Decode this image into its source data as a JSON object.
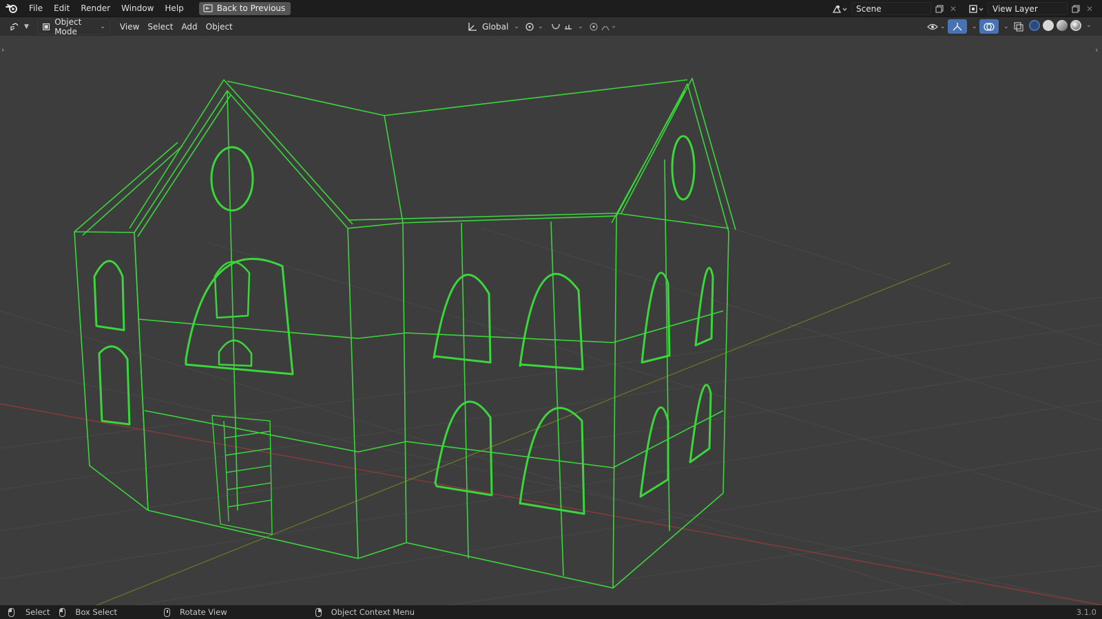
{
  "topbar": {
    "menu": [
      "File",
      "Edit",
      "Render",
      "Window",
      "Help"
    ],
    "back_button": "Back to Previous",
    "scene_label": "Scene",
    "view_layer_label": "View Layer"
  },
  "header": {
    "mode": "Object Mode",
    "menu": [
      "View",
      "Select",
      "Add",
      "Object"
    ],
    "orientation": "Global"
  },
  "statusbar": {
    "select": "Select",
    "box_select": "Box Select",
    "rotate_view": "Rotate View",
    "context_menu": "Object Context Menu",
    "version": "3.1.0"
  },
  "colors": {
    "wire": "#3bd63b",
    "viewport_bg": "#3d3d3d",
    "x_axis": "#8a3a3a",
    "y_axis": "#6a7a2a",
    "active_shading": "#4772b3"
  },
  "icons": [
    "blender-logo-icon",
    "back-icon",
    "scene-icon",
    "view-layer-icon",
    "editor-type-icon",
    "orientation-icon",
    "pivot-icon",
    "snap-icon",
    "proportional-icon",
    "visibility-icon",
    "gizmo-icon",
    "overlay-icon",
    "xray-icon",
    "wireframe-shading-icon",
    "solid-shading-icon",
    "material-shading-icon",
    "rendered-shading-icon"
  ]
}
